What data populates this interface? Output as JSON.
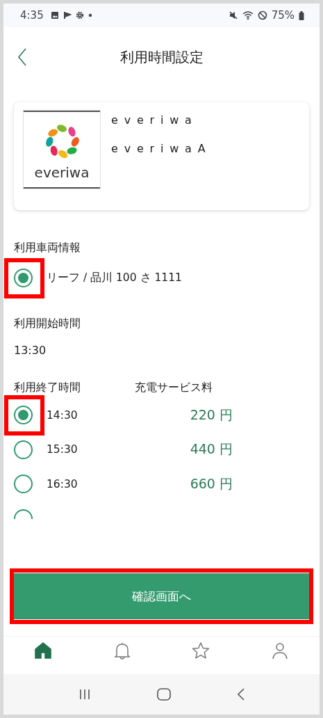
{
  "status_bar": {
    "time": "4:35",
    "battery": "75%"
  },
  "header": {
    "title": "利用時間設定"
  },
  "shop": {
    "logo_text": "everiwa",
    "name": "everiwa",
    "sub_name": "everiwaA"
  },
  "vehicle": {
    "label": "利用車両情報",
    "options": [
      {
        "text": "リーフ / 品川 100 さ 1111",
        "selected": true,
        "highlighted": true
      }
    ]
  },
  "start": {
    "label": "利用開始時間",
    "value": "13:30"
  },
  "end": {
    "label": "利用終了時間",
    "fee_label": "充電サービス料",
    "options": [
      {
        "time": "14:30",
        "fee": "220 円",
        "selected": true,
        "highlighted": true
      },
      {
        "time": "15:30",
        "fee": "440 円",
        "selected": false,
        "highlighted": false
      },
      {
        "time": "16:30",
        "fee": "660 円",
        "selected": false,
        "highlighted": false
      },
      {
        "selected": false,
        "highlighted": false
      }
    ]
  },
  "confirm_button": {
    "label": "確認画面へ",
    "highlighted": true
  },
  "bottom_nav": [
    {
      "kind": "home",
      "selected": true
    },
    {
      "kind": "bell",
      "selected": false
    },
    {
      "kind": "star",
      "selected": false
    },
    {
      "kind": "person",
      "selected": false
    }
  ]
}
